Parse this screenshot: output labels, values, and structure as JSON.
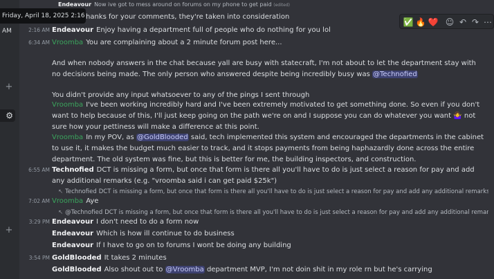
{
  "tooltip": "Friday, April 18, 2025 2:16 AM",
  "toolbar": {
    "reaction_check": "✅",
    "reaction_fire": "🔥",
    "reaction_heart": "❤️",
    "add_reaction": "☺",
    "reply": "↶",
    "forward": "↷",
    "more": "⋯"
  },
  "messages": {
    "m0": {
      "author": "Endeavour",
      "text": "Now ive got to mess around on forums on my phone to get paid",
      "edited": "(edited)"
    },
    "m1": {
      "text": "hanks for your comments, they're taken into consideration"
    },
    "m2": {
      "time": "2:16 AM",
      "author": "Endeavour",
      "text": "Enjoy having a department full of people who do nothing for you lol"
    },
    "m3": {
      "time": "6:34 AM",
      "author": "Vroomba",
      "line1": "You are complaining about a 2 minute forum post here...",
      "line2": "And when nobody answers in the chat because yall are busy with statecraft, I'm not about to let the department stay with no decisions being made. The only person who answered despite being incredibly busy was",
      "mention": "@Technofied",
      "line3": "You didn't provide any input whatsoever to any of the pings I sent through"
    },
    "m4": {
      "author": "Vroomba",
      "text": "I've been working incredibly hard and I've been extremely motivated to get something done. So even if you don't want to help because of this, I'll just keep going on the path we're on and I suppose you can do whatever you want",
      "emoji": "🤷‍♀️",
      "text2": "not sure how your pettiness will make a difference at this point."
    },
    "m5": {
      "author": "Vroomba",
      "pre": "In my POV, as",
      "mention": "@GoldBlooded",
      "text": "said, tech implemented this system and encouraged the departments in the cabinet to use it, it makes the budget much easier to track, and it stops payments from being haphazardly done across the entire department. The old system was fine, but this is better for me, the building inspectors, and construction."
    },
    "m6": {
      "time": "6:55 AM",
      "author": "Technofied",
      "text": "DCT is missing a form, but once that form is there all you'll have to do is just select a reason for pay and add any additional remarks (e.g. \"vroomba said i can get paid $25k\")"
    },
    "r1": {
      "author": "Technofied",
      "text": "DCT is missing a form, but once that form is there all you'll have to do is just select a reason for pay and add any additional remarks (e.g. \"vroo..."
    },
    "m7": {
      "time": "7:02 AM",
      "author": "Vroomba",
      "text": "Aye"
    },
    "r2": {
      "author": "@Technofied",
      "text": "DCT is missing a form, but once that form is there all you'll have to do is just select a reason for pay and add any additional remarks (e.g. \"vro..."
    },
    "m8": {
      "time": "3:29 PM",
      "author": "Endeavour",
      "text": "I don't need to do a form now"
    },
    "m9": {
      "author": "Endeavour",
      "text": "Which is how ill continue to do business"
    },
    "m10": {
      "author": "Endeavour",
      "text": "If I have to go on to forums I wont be doing any building"
    },
    "m11": {
      "time": "3:54 PM",
      "author": "GoldBlooded",
      "text": "It takes 2 minutes"
    },
    "m12": {
      "author": "GoldBlooded",
      "pre": "Also shout out to",
      "mention": "@Vroomba",
      "text": "department MVP, I'm not doin shit in my role rn but he's carrying"
    }
  },
  "gutter": {
    "plus": "+",
    "gear": "⚙"
  }
}
